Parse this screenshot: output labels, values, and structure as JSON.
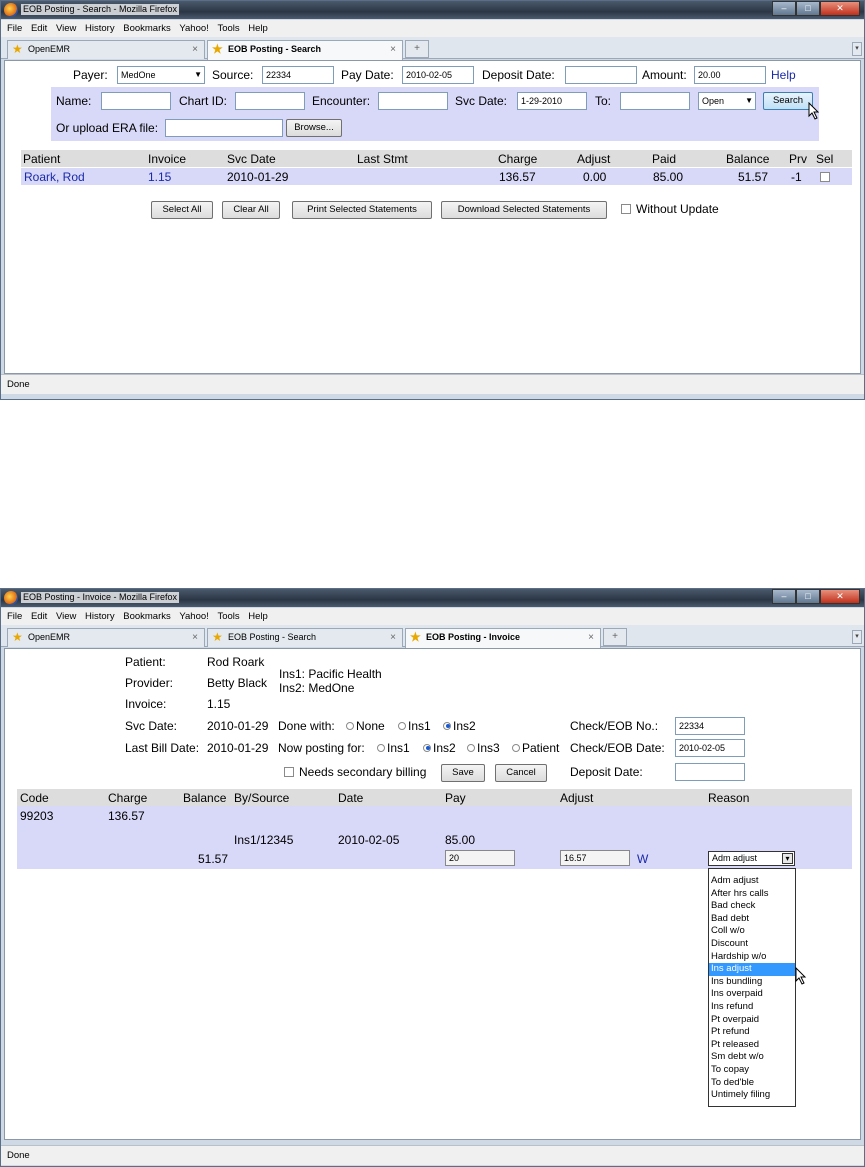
{
  "window1": {
    "title": "EOB Posting - Search - Mozilla Firefox",
    "menu": [
      "File",
      "Edit",
      "View",
      "History",
      "Bookmarks",
      "Yahoo!",
      "Tools",
      "Help"
    ],
    "tabs": [
      {
        "label": "OpenEMR"
      },
      {
        "label": "EOB Posting - Search"
      }
    ],
    "form": {
      "payer_label": "Payer:",
      "payer_value": "MedOne",
      "source_label": "Source:",
      "source_value": "22334",
      "pay_date_label": "Pay Date:",
      "pay_date_value": "2010-02-05",
      "deposit_date_label": "Deposit Date:",
      "deposit_date_value": "",
      "amount_label": "Amount:",
      "amount_value": "20.00",
      "help_link": "Help",
      "name_label": "Name:",
      "chart_id_label": "Chart ID:",
      "encounter_label": "Encounter:",
      "svc_date_label": "Svc Date:",
      "svc_date_value": "1-29-2010",
      "to_label": "To:",
      "status_value": "Open",
      "search_button": "Search",
      "upload_label": "Or upload ERA file:",
      "browse_button": "Browse..."
    },
    "table": {
      "headers": [
        "Patient",
        "Invoice",
        "Svc Date",
        "Last Stmt",
        "Charge",
        "Adjust",
        "Paid",
        "Balance",
        "Prv",
        "Sel"
      ],
      "row": {
        "patient": "Roark, Rod",
        "invoice": "1.15",
        "svc_date": "2010-01-29",
        "last_stmt": "",
        "charge": "136.57",
        "adjust": "0.00",
        "paid": "85.00",
        "balance": "51.57",
        "prv": "-1"
      }
    },
    "buttons": {
      "select_all": "Select All",
      "clear_all": "Clear All",
      "print": "Print Selected Statements",
      "download": "Download Selected Statements",
      "without_update": "Without Update"
    },
    "status": "Done"
  },
  "window2": {
    "title": "EOB Posting - Invoice - Mozilla Firefox",
    "menu": [
      "File",
      "Edit",
      "View",
      "History",
      "Bookmarks",
      "Yahoo!",
      "Tools",
      "Help"
    ],
    "tabs": [
      {
        "label": "OpenEMR"
      },
      {
        "label": "EOB Posting - Search"
      },
      {
        "label": "EOB Posting - Invoice"
      }
    ],
    "info": {
      "patient_label": "Patient:",
      "patient_value": "Rod Roark",
      "provider_label": "Provider:",
      "provider_value": "Betty Black",
      "ins1": "Ins1: Pacific Health",
      "ins2": "Ins2: MedOne",
      "invoice_label": "Invoice:",
      "invoice_value": "1.15",
      "svc_date_label": "Svc Date:",
      "svc_date_value": "2010-01-29",
      "done_with_label": "Done with:",
      "done_none": "None",
      "done_ins1": "Ins1",
      "done_ins2": "Ins2",
      "check_no_label": "Check/EOB No.:",
      "check_no_value": "22334",
      "last_bill_label": "Last Bill Date:",
      "last_bill_value": "2010-01-29",
      "posting_for_label": "Now posting for:",
      "post_ins1": "Ins1",
      "post_ins2": "Ins2",
      "post_ins3": "Ins3",
      "post_patient": "Patient",
      "check_date_label": "Check/EOB Date:",
      "check_date_value": "2010-02-05",
      "needs_secondary": "Needs secondary billing",
      "save_button": "Save",
      "cancel_button": "Cancel",
      "deposit_label": "Deposit Date:"
    },
    "table": {
      "headers": [
        "Code",
        "Charge",
        "Balance",
        "By/Source",
        "Date",
        "Pay",
        "Adjust",
        "Reason"
      ],
      "code": "99203",
      "charge": "136.57",
      "source": "Ins1/12345",
      "date": "2010-02-05",
      "pay": "85.00",
      "balance": "51.57",
      "pay_input": "20",
      "adjust_input": "16.57",
      "w_link": "W",
      "reason_selected": "Adm adjust"
    },
    "dropdown_options": [
      "Adm adjust",
      "After hrs calls",
      "Bad check",
      "Bad debt",
      "Coll w/o",
      "Discount",
      "Hardship w/o",
      "Ins adjust",
      "Ins bundling",
      "Ins overpaid",
      "Ins refund",
      "Pt overpaid",
      "Pt refund",
      "Pt released",
      "Sm debt w/o",
      "To copay",
      "To ded'ble",
      "Untimely filing"
    ],
    "dropdown_highlight_index": 7,
    "status": "Done"
  }
}
